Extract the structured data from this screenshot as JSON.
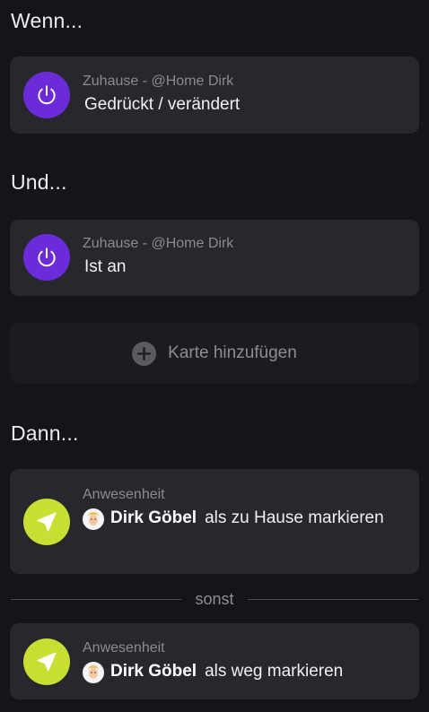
{
  "sections": {
    "when": "Wenn...",
    "and": "Und...",
    "then": "Dann..."
  },
  "when_card": {
    "subtitle": "Zuhause - @Home Dirk",
    "title": "Gedrückt / verändert",
    "icon": "power-icon",
    "icon_color": "#6c2bd9"
  },
  "and_card": {
    "subtitle": "Zuhause - @Home Dirk",
    "title": "Ist an",
    "icon": "power-icon",
    "icon_color": "#6c2bd9"
  },
  "add_card": {
    "label": "Karte hinzufügen",
    "icon": "plus-icon"
  },
  "then_card": {
    "subtitle": "Anwesenheit",
    "user": "Dirk Göbel",
    "action": "als zu Hause markieren",
    "icon": "location-arrow-icon",
    "icon_color": "#c9df34"
  },
  "divider": {
    "label": "sonst"
  },
  "else_card": {
    "subtitle": "Anwesenheit",
    "user": "Dirk Göbel",
    "action": "als weg markieren",
    "icon": "location-arrow-icon",
    "icon_color": "#c9df34"
  }
}
